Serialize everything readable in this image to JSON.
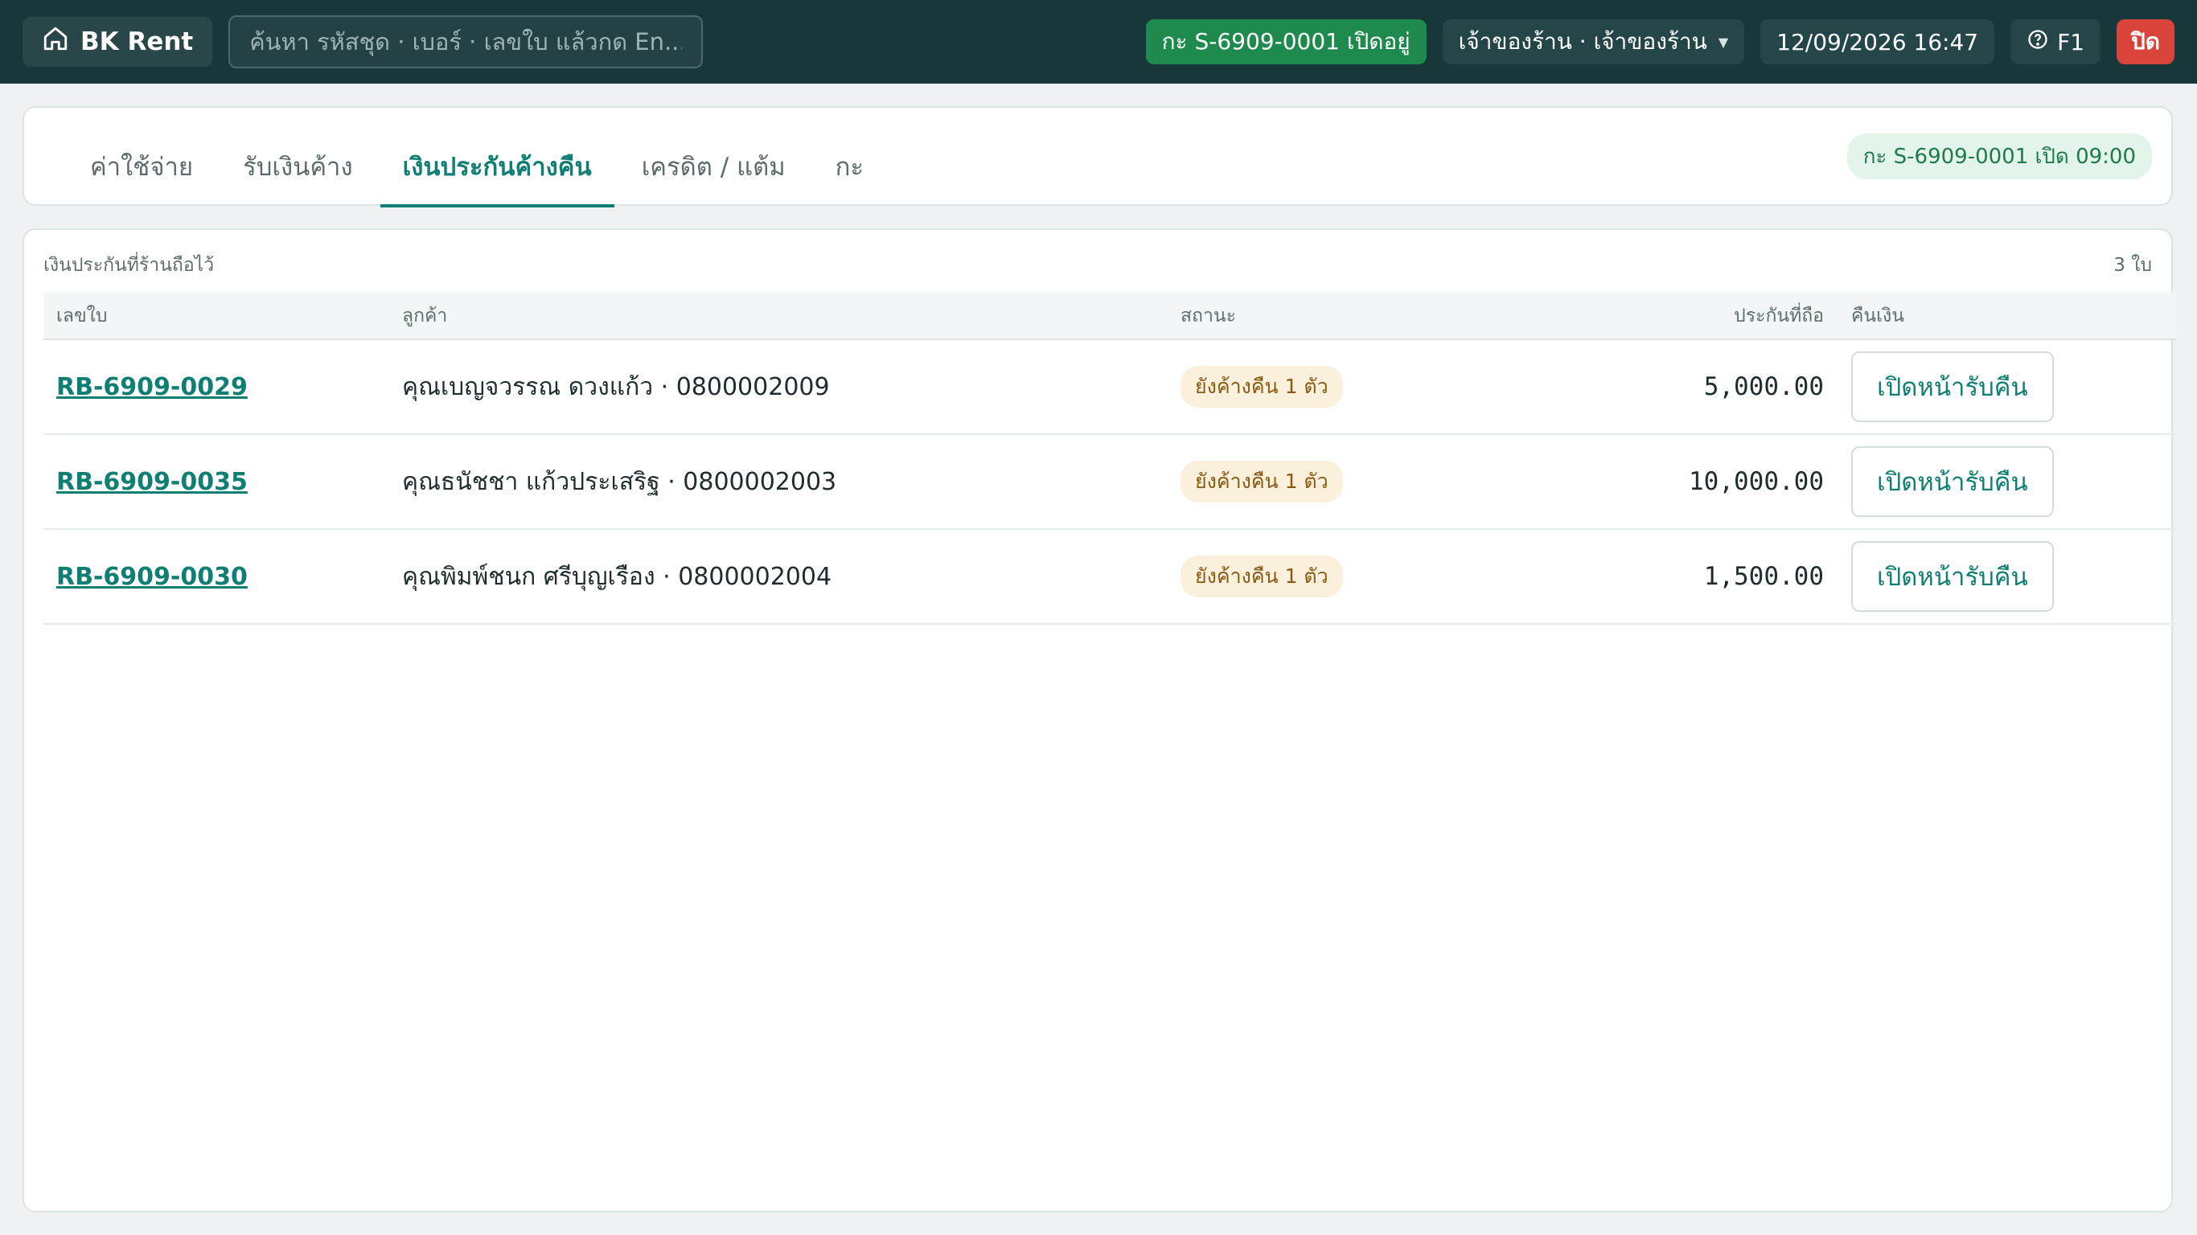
{
  "header": {
    "brand": "BK Rent",
    "brand_icon": "home-icon",
    "search_placeholder": "ค้นหา รหัสชุด · เบอร์ · เลขใบ แล้วกด En...",
    "shift_status": "กะ S-6909-0001 เปิดอยู่",
    "user": "เจ้าของร้าน · เจ้าของร้าน",
    "datetime": "12/09/2026 16:47",
    "help_label": "F1",
    "close_label": "ปิด",
    "colors": {
      "bar": "#17373a",
      "shift": "#1f8a4e",
      "close": "#d9443a"
    }
  },
  "tabs": {
    "items": [
      {
        "label": "ค่าใช้จ่าย",
        "active": false
      },
      {
        "label": "รับเงินค้าง",
        "active": false
      },
      {
        "label": "เงินประกันค้างคืน",
        "active": true
      },
      {
        "label": "เครดิต / แต้ม",
        "active": false
      },
      {
        "label": "กะ",
        "active": false
      }
    ],
    "shift_badge": "กะ S-6909-0001 เปิด 09:00"
  },
  "deposits": {
    "title": "เงินประกันที่ร้านถือไว้",
    "count": "3 ใบ",
    "columns": {
      "id": "เลขใบ",
      "customer": "ลูกค้า",
      "status": "สถานะ",
      "amount": "ประกันที่ถือ",
      "action": "คืนเงิน"
    },
    "rows": [
      {
        "id": "RB-6909-0029",
        "customer": "คุณเบญจวรรณ ดวงแก้ว · 0800002009",
        "status": "ยังค้างคืน 1 ตัว",
        "amount": "5,000.00",
        "action": "เปิดหน้ารับคืน"
      },
      {
        "id": "RB-6909-0035",
        "customer": "คุณธนัชชา แก้วประเสริฐ · 0800002003",
        "status": "ยังค้างคืน 1 ตัว",
        "amount": "10,000.00",
        "action": "เปิดหน้ารับคืน"
      },
      {
        "id": "RB-6909-0030",
        "customer": "คุณพิมพ์ชนก ศรีบุญเรือง · 0800002004",
        "status": "ยังค้างคืน 1 ตัว",
        "amount": "1,500.00",
        "action": "เปิดหน้ารับคืน"
      }
    ]
  }
}
